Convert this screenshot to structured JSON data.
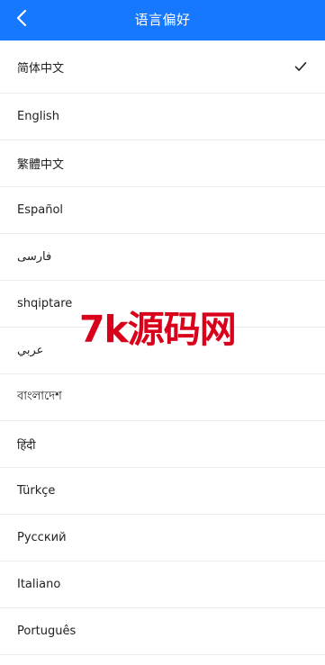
{
  "header": {
    "title": "语言偏好",
    "back_icon": "chevron-left-icon",
    "background": "#1677ff"
  },
  "languages": [
    {
      "label": "简体中文",
      "selected": true
    },
    {
      "label": "English",
      "selected": false
    },
    {
      "label": "繁體中文",
      "selected": false
    },
    {
      "label": "Español",
      "selected": false
    },
    {
      "label": "فارسی",
      "selected": false
    },
    {
      "label": "shqiptare",
      "selected": false
    },
    {
      "label": "عربي",
      "selected": false
    },
    {
      "label": "বাংলাদেশ",
      "selected": false
    },
    {
      "label": "हिंदी",
      "selected": false
    },
    {
      "label": "Türkçe",
      "selected": false
    },
    {
      "label": "Русский",
      "selected": false
    },
    {
      "label": "Italiano",
      "selected": false
    },
    {
      "label": "Português",
      "selected": false
    }
  ],
  "selected_icon": "checkmark-icon",
  "watermark": {
    "text": "7k源码网",
    "color": "#d9001b"
  }
}
